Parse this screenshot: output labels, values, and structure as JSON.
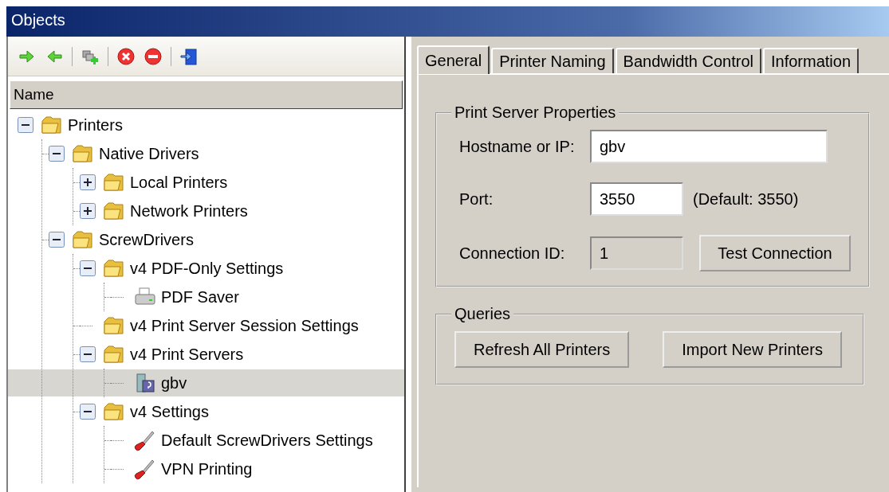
{
  "window": {
    "title": "Objects"
  },
  "toolbar": [
    {
      "kind": "forward"
    },
    {
      "kind": "back"
    },
    {
      "kind": "sep"
    },
    {
      "kind": "add"
    },
    {
      "kind": "sep"
    },
    {
      "kind": "delete"
    },
    {
      "kind": "remove"
    },
    {
      "kind": "sep"
    },
    {
      "kind": "exit"
    }
  ],
  "tree_header": "Name",
  "tree": [
    {
      "label": "Printers",
      "kind": "folder",
      "expanded": true,
      "selected": false,
      "children": [
        {
          "label": "Native Drivers",
          "kind": "folder",
          "expanded": true,
          "selected": false,
          "children": [
            {
              "label": "Local Printers",
              "kind": "folder",
              "expanded": false,
              "selected": false
            },
            {
              "label": "Network Printers",
              "kind": "folder",
              "expanded": false,
              "selected": false
            }
          ]
        },
        {
          "label": "ScrewDrivers",
          "kind": "folder",
          "expanded": true,
          "selected": false,
          "children": [
            {
              "label": "v4 PDF-Only Settings",
              "kind": "folder",
              "expanded": true,
              "selected": false,
              "children": [
                {
                  "label": "PDF Saver",
                  "kind": "printer",
                  "selected": false
                }
              ]
            },
            {
              "label": "v4 Print Server Session Settings",
              "kind": "folder",
              "selected": false
            },
            {
              "label": "v4 Print Servers",
              "kind": "folder",
              "expanded": true,
              "selected": false,
              "children": [
                {
                  "label": "gbv",
                  "kind": "server",
                  "selected": true
                }
              ]
            },
            {
              "label": "v4 Settings",
              "kind": "folder",
              "expanded": true,
              "selected": false,
              "children": [
                {
                  "label": "Default ScrewDrivers Settings",
                  "kind": "wrench",
                  "selected": false
                },
                {
                  "label": "VPN Printing",
                  "kind": "wrench",
                  "selected": false
                }
              ]
            }
          ]
        }
      ]
    }
  ],
  "tabs": [
    {
      "label": "General",
      "selected": true
    },
    {
      "label": "Printer Naming",
      "selected": false
    },
    {
      "label": "Bandwidth Control",
      "selected": false
    },
    {
      "label": "Information",
      "selected": false
    }
  ],
  "print_server_properties": {
    "title": "Print Server Properties",
    "hostname_label": "Hostname or IP:",
    "hostname_value": "gbv",
    "port_label": "Port:",
    "port_value": "3550",
    "port_default": "(Default: 3550)",
    "connection_id_label": "Connection ID:",
    "connection_id_value": "1",
    "connection_id_disabled": true,
    "test_button": "Test Connection"
  },
  "queries": {
    "title": "Queries",
    "buttons": [
      "Refresh All Printers",
      "Import New Printers"
    ]
  }
}
